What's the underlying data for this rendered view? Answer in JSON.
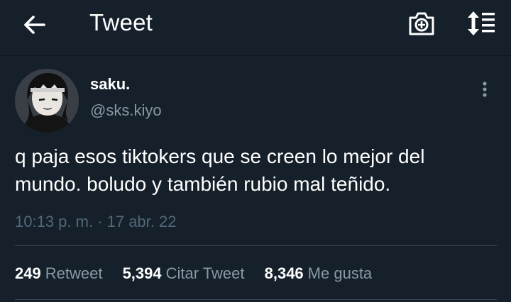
{
  "header": {
    "title": "Tweet",
    "back_icon": "arrow-left-icon",
    "camera_icon": "camera-plus-icon",
    "sort_icon": "sort-lines-icon"
  },
  "tweet": {
    "author_name": "saku.",
    "author_handle": "@sks.kiyo",
    "text_line1": "q paja esos tiktokers que se creen lo mejor del",
    "text_line2": "mundo. boludo y también rubio mal teñido.",
    "timestamp": "10:13 p. m. · 17 abr. 22"
  },
  "stats": {
    "retweets_count": "249",
    "retweets_label": "Retweet",
    "quotes_count": "5,394",
    "quotes_label": "Citar Tweet",
    "likes_count": "8,346",
    "likes_label": "Me gusta"
  },
  "colors": {
    "background": "#15202b",
    "primary_text": "#ffffff",
    "secondary_text": "#8899a6",
    "timestamp_text": "#526878",
    "divider": "#38444d"
  }
}
